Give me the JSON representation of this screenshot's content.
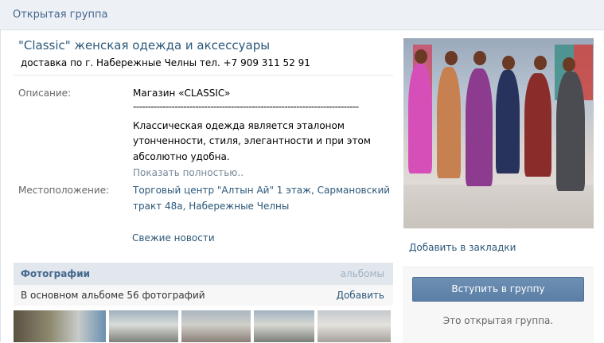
{
  "topbar": {
    "title": "Открытая группа"
  },
  "group": {
    "name": "\"Classic\" женская одежда и аксессуары",
    "status": "доставка по г. Набережные Челны тел. +7 909 311 52 91"
  },
  "info": {
    "description_label": "Описание:",
    "description_line1": "Магазин «CLASSIC»",
    "description_dashes": "----------------------------------------------------------------------------",
    "description_line2": "Классическая одежда является эталоном",
    "description_line3": "утонченности, стиля, элегантности и при этом",
    "description_line4": "абсолютно удобна.",
    "show_more": "Показать полностью..",
    "location_label": "Местоположение:",
    "location_line1": "Торговый центр \"Алтын Ай\" 1 этаж, Сармановский",
    "location_line2": "тракт 48а, Набережные Челны",
    "news_link": "Свежие новости"
  },
  "photos": {
    "title": "Фотографии",
    "albums_link": "альбомы",
    "count_text": "В основном альбоме 56 фотографий",
    "add_link": "Добавить",
    "thumbnail_count": 5
  },
  "sidebar": {
    "bookmark_link": "Добавить в закладки",
    "join_button": "Вступить в группу",
    "open_note": "Это открытая группа."
  },
  "colors": {
    "link": "#2b587a",
    "header_bg": "#edf1f5",
    "button_bg": "#5b7fa6"
  }
}
